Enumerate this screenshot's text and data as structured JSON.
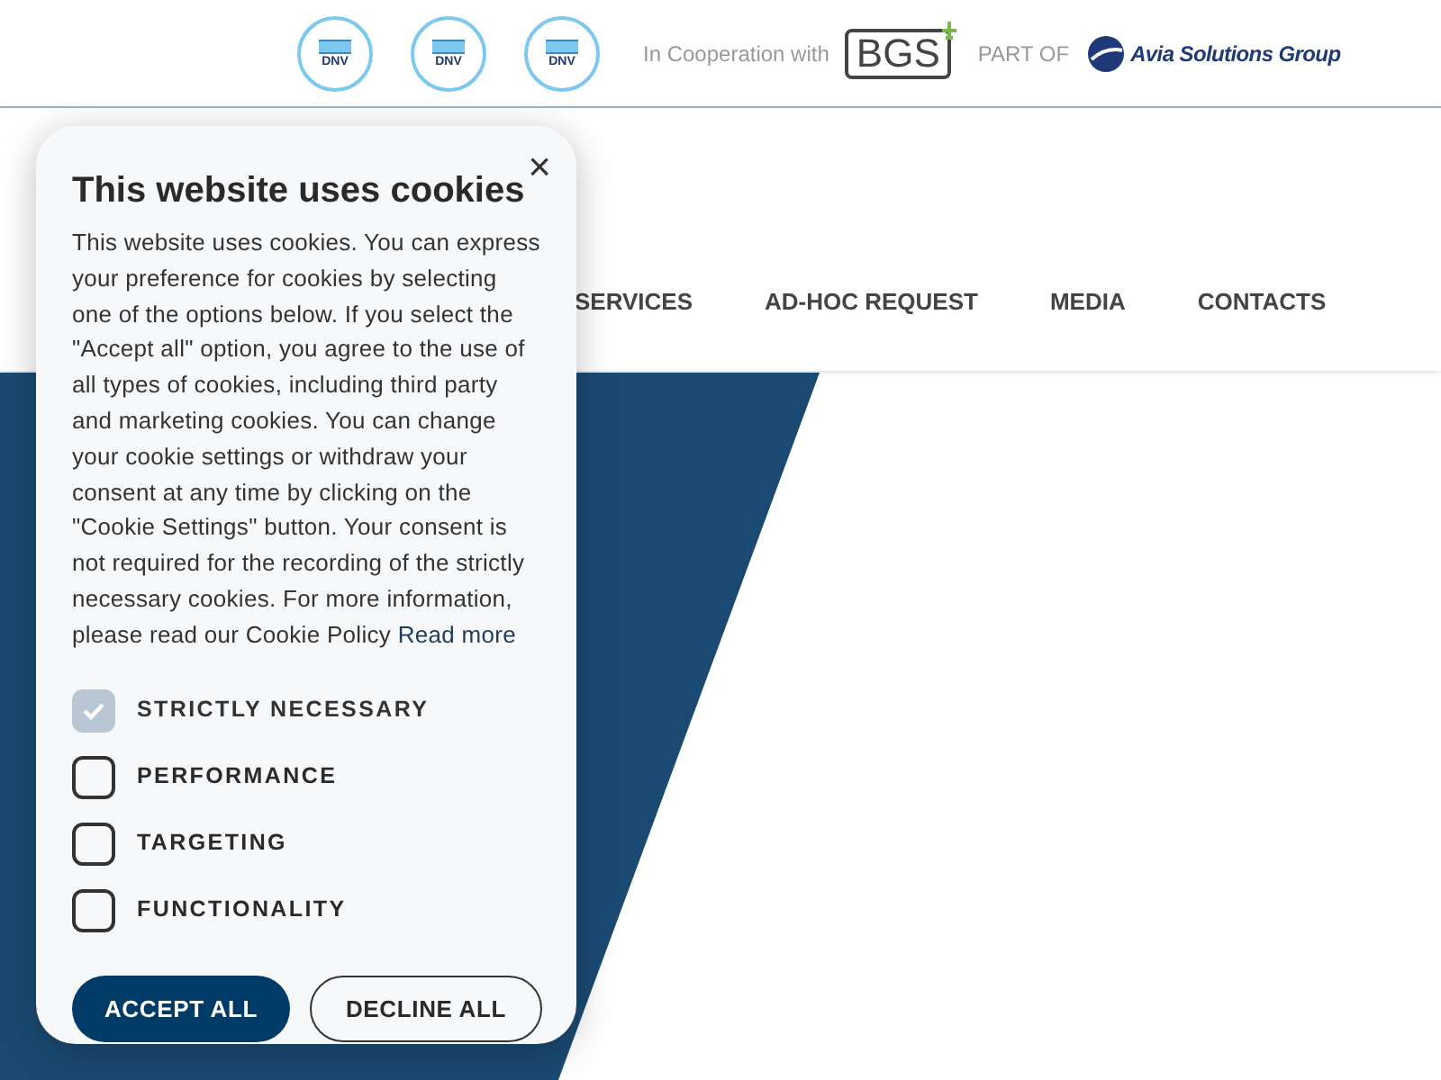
{
  "top_bar": {
    "certifications": [
      {
        "label": "DNV"
      },
      {
        "label": "DNV"
      },
      {
        "label": "DNV"
      }
    ],
    "cooperation_text": "In Cooperation with",
    "partner_logo": "BGS",
    "part_of_text": "PART OF",
    "group_logo": "Avia Solutions Group"
  },
  "nav": {
    "items": [
      {
        "label": "SERVICES"
      },
      {
        "label": "AD-HOC REQUEST"
      },
      {
        "label": "MEDIA"
      },
      {
        "label": "CONTACTS"
      }
    ]
  },
  "cookie_dialog": {
    "title": "This website uses cookies",
    "close": "×",
    "body": "This website uses cookies. You can express your preference for cookies by selecting one of the options below. If you select the \"Accept all\" option, you agree to the use of all types of cookies, including third party and marketing cookies. You can change your cookie settings or withdraw your consent at any time by clicking on the \"Cookie Settings\" button. Your consent is not required for the recording of the strictly necessary cookies. For more information, please read our Cookie Policy",
    "read_more": "Read more",
    "options": [
      {
        "label": "STRICTLY NECESSARY",
        "checked": true,
        "disabled": true
      },
      {
        "label": "PERFORMANCE",
        "checked": false,
        "disabled": false
      },
      {
        "label": "TARGETING",
        "checked": false,
        "disabled": false
      },
      {
        "label": "FUNCTIONALITY",
        "checked": false,
        "disabled": false
      }
    ],
    "buttons": [
      {
        "label": "ACCEPT ALL",
        "kind": "primary"
      },
      {
        "label": "DECLINE ALL",
        "kind": "secondary"
      }
    ]
  }
}
